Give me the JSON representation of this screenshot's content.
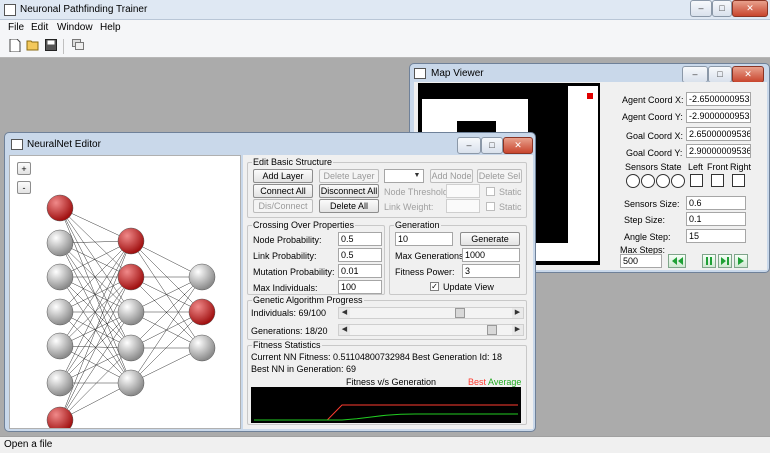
{
  "app": {
    "title": "Neuronal Pathfinding Trainer",
    "status": "Open a file"
  },
  "menu": [
    "File",
    "Edit",
    "Window",
    "Help"
  ],
  "window_buttons": {
    "minimize": "–",
    "maximize": "□",
    "close": "✕"
  },
  "colors": {
    "accent_red": "#b41818",
    "neuron_gray": "#a8a8a8",
    "best": "#ff3b30",
    "average": "#22cc22",
    "map_black": "#000000",
    "agent": "#e00000"
  },
  "map_viewer": {
    "title": "Map Viewer",
    "agent_x_label": "Agent Coord X:",
    "agent_x": "-2.6500000953",
    "agent_y_label": "Agent Coord Y:",
    "agent_y": "-2.9000000953",
    "goal_x_label": "Goal Coord X:",
    "goal_x": "2.65000009536",
    "goal_y_label": "Goal Coord Y:",
    "goal_y": "2.90000009536",
    "sensors_state_label": "Sensors State",
    "left_label": "Left",
    "front_label": "Front",
    "right_label": "Right",
    "sensors_size_label": "Sensors Size:",
    "sensors_size": "0.6",
    "step_size_label": "Step Size:",
    "step_size": "0.1",
    "angle_step_label": "Angle Step:",
    "angle_step": "15",
    "max_steps_label": "Max Steps:",
    "max_steps": "500"
  },
  "nn_editor": {
    "title": "NeuralNet Editor",
    "plus": "+",
    "minus": "-",
    "edit_structure": {
      "title": "Edit Basic Structure",
      "add_layer": "Add Layer",
      "delete_layer": "Delete Layer",
      "add_node": "Add Node",
      "delete_sel": "Delete Sel",
      "connect_all": "Connect All",
      "disconnect_all": "Disconnect All",
      "dis_connect": "Dis/Connect",
      "delete_all": "Delete All",
      "node_threshold_label": "Node Threshold:",
      "link_weight_label": "Link Weight:",
      "static_label": "Static"
    },
    "crossing": {
      "title": "Crossing Over Properties",
      "node_prob_label": "Node Probability:",
      "node_prob": "0.5",
      "link_prob_label": "Link Probability:",
      "link_prob": "0.5",
      "mutation_prob_label": "Mutation Probability:",
      "mutation_prob": "0.01",
      "max_individuals_label": "Max Individuals:",
      "max_individuals": "100"
    },
    "generation": {
      "title": "Generation",
      "value": "10",
      "generate": "Generate",
      "max_generations_label": "Max Generations:",
      "max_generations": "1000",
      "fitness_power_label": "Fitness Power:",
      "fitness_power": "3",
      "update_view_label": "Update View",
      "update_view_checked": "✓"
    },
    "progress": {
      "title": "Genetic Algorithm Progress",
      "individuals_label": "Individuals: 69/100",
      "individuals_fraction": 0.69,
      "generations_label": "Generations: 18/20",
      "generations_fraction": 0.9
    },
    "fitness": {
      "title": "Fitness Statistics",
      "current_label": "Current NN Fitness: 0.51104800732984",
      "best_gen_label": "Best Generation Id: 18",
      "best_nn_label": "Best NN in Generation: 69"
    }
  },
  "chart_data": {
    "type": "line",
    "title": "Fitness v/s Generation",
    "series": [
      {
        "name": "Best",
        "color": "#ff3b30",
        "values": [
          0.0,
          0.0,
          0.0,
          0.0,
          0.0,
          0.0,
          0.5,
          0.5,
          0.5,
          0.5,
          0.5,
          0.5,
          0.5,
          0.5,
          0.5,
          0.5,
          0.5,
          0.5,
          0.5
        ]
      },
      {
        "name": "Average",
        "color": "#22cc22",
        "values": [
          0.0,
          0.0,
          0.0,
          0.0,
          0.0,
          0.0,
          0.0,
          0.04,
          0.1,
          0.16,
          0.19,
          0.2,
          0.2,
          0.2,
          0.2,
          0.2,
          0.2,
          0.2,
          0.2
        ]
      }
    ],
    "ylim": [
      0,
      1
    ],
    "grid": false
  }
}
